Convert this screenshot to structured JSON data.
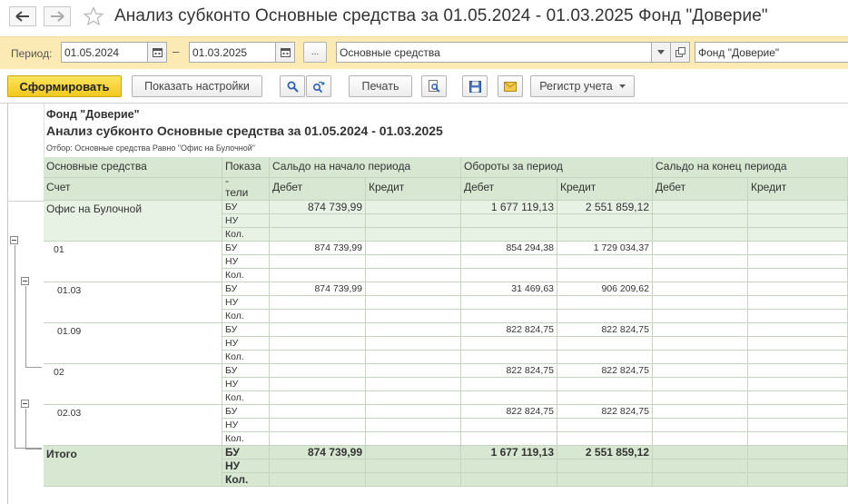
{
  "window": {
    "title": "Анализ субконто Основные средства за 01.05.2024 - 01.03.2025 Фонд \"Доверие\""
  },
  "filters": {
    "period_label": "Период:",
    "date_from": "01.05.2024",
    "date_separator": "–",
    "date_to": "01.03.2025",
    "ellipsis": "...",
    "subconto": "Основные средства",
    "organization": "Фонд \"Доверие\""
  },
  "toolbar": {
    "generate_label": "Сформировать",
    "settings_label": "Показать настройки",
    "print_label": "Печать",
    "register_label": "Регистр учета"
  },
  "report": {
    "organization": "Фонд \"Доверие\"",
    "title": "Анализ субконто Основные средства за 01.05.2024 - 01.03.2025",
    "filter": "Отбор: Основные средства Равно \"Офис на Булочной\"",
    "headers": {
      "col_asset": "Основные средства",
      "col_account": "Счет",
      "col_indicator_top": "Показа",
      "col_indicator_mid": "-",
      "col_indicator_bot": "тели",
      "col_open": "Сальдо на начало периода",
      "col_turnover": "Обороты за период",
      "col_close": "Сальдо на конец периода",
      "debit": "Дебет",
      "credit": "Кредит"
    },
    "groups": [
      {
        "label": "Офис на Булочной",
        "rows": [
          {
            "ind": "БУ",
            "open_debit": "874 739,99",
            "turn_debit": "1 677 119,13",
            "turn_credit": "2 551 859,12"
          },
          {
            "ind": "НУ",
            "open_debit": "",
            "turn_debit": "",
            "turn_credit": ""
          },
          {
            "ind": "Кол.",
            "open_debit": "",
            "turn_debit": "",
            "turn_credit": ""
          }
        ]
      },
      {
        "label": "01",
        "rows": [
          {
            "ind": "БУ",
            "open_debit": "874 739,99",
            "turn_debit": "854 294,38",
            "turn_credit": "1 729 034,37"
          },
          {
            "ind": "НУ",
            "open_debit": "",
            "turn_debit": "",
            "turn_credit": ""
          },
          {
            "ind": "Кол.",
            "open_debit": "",
            "turn_debit": "",
            "turn_credit": ""
          }
        ]
      },
      {
        "label": "01.03",
        "rows": [
          {
            "ind": "БУ",
            "open_debit": "874 739,99",
            "turn_debit": "31 469,63",
            "turn_credit": "906 209,62"
          },
          {
            "ind": "НУ",
            "open_debit": "",
            "turn_debit": "",
            "turn_credit": ""
          },
          {
            "ind": "Кол.",
            "open_debit": "",
            "turn_debit": "",
            "turn_credit": ""
          }
        ]
      },
      {
        "label": "01.09",
        "rows": [
          {
            "ind": "БУ",
            "open_debit": "",
            "turn_debit": "822 824,75",
            "turn_credit": "822 824,75"
          },
          {
            "ind": "НУ",
            "open_debit": "",
            "turn_debit": "",
            "turn_credit": ""
          },
          {
            "ind": "Кол.",
            "open_debit": "",
            "turn_debit": "",
            "turn_credit": ""
          }
        ]
      },
      {
        "label": "02",
        "rows": [
          {
            "ind": "БУ",
            "open_debit": "",
            "turn_debit": "822 824,75",
            "turn_credit": "822 824,75"
          },
          {
            "ind": "НУ",
            "open_debit": "",
            "turn_debit": "",
            "turn_credit": ""
          },
          {
            "ind": "Кол.",
            "open_debit": "",
            "turn_debit": "",
            "turn_credit": ""
          }
        ]
      },
      {
        "label": "02.03",
        "rows": [
          {
            "ind": "БУ",
            "open_debit": "",
            "turn_debit": "822 824,75",
            "turn_credit": "822 824,75"
          },
          {
            "ind": "НУ",
            "open_debit": "",
            "turn_debit": "",
            "turn_credit": ""
          },
          {
            "ind": "Кол.",
            "open_debit": "",
            "turn_debit": "",
            "turn_credit": ""
          }
        ]
      },
      {
        "label": "Итого",
        "rows": [
          {
            "ind": "БУ",
            "open_debit": "874 739,99",
            "turn_debit": "1 677 119,13",
            "turn_credit": "2 551 859,12"
          },
          {
            "ind": "НУ",
            "open_debit": "",
            "turn_debit": "",
            "turn_credit": ""
          },
          {
            "ind": "Кол.",
            "open_debit": "",
            "turn_debit": "",
            "turn_credit": ""
          }
        ]
      }
    ]
  },
  "colors": {
    "header_bg": "#d7e7d2",
    "group_bg": "#e8f2e4",
    "total_bg": "#d7e7d2",
    "grid": "#c4d4bf",
    "accent": "#f3cd26",
    "filter_bar": "#fbeab3"
  },
  "icons": [
    "back-arrow-icon",
    "forward-arrow-icon",
    "favorite-star-icon",
    "calendar-icon",
    "dropdown-arrow-icon",
    "open-form-icon",
    "search-icon",
    "find-next-icon",
    "print-preview-icon",
    "save-icon",
    "email-icon"
  ]
}
